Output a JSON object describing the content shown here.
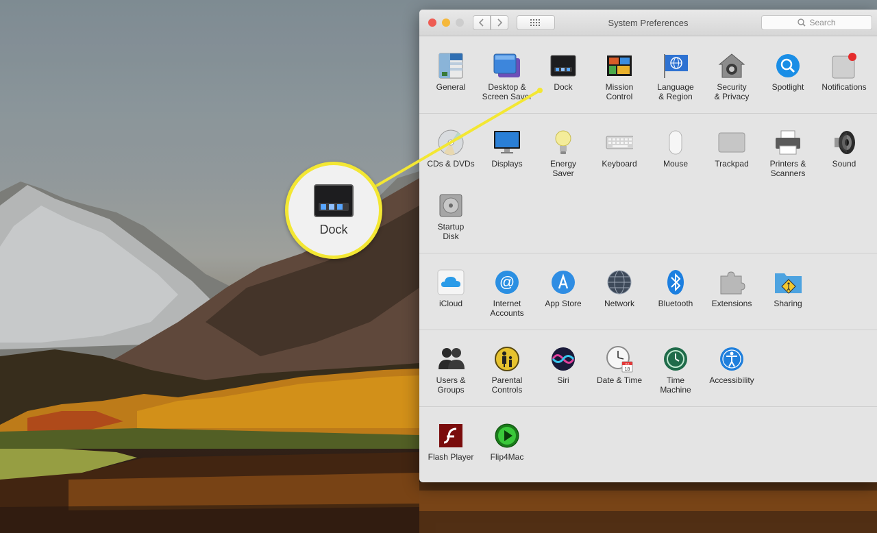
{
  "window": {
    "title": "System Preferences",
    "search_placeholder": "Search"
  },
  "callout": {
    "label": "Dock"
  },
  "sections": [
    {
      "panes": [
        {
          "label": "General",
          "icon": "general-icon"
        },
        {
          "label": "Desktop &\nScreen Saver",
          "icon": "desktop-screen-saver-icon"
        },
        {
          "label": "Dock",
          "icon": "dock-icon"
        },
        {
          "label": "Mission\nControl",
          "icon": "mission-control-icon"
        },
        {
          "label": "Language\n& Region",
          "icon": "language-region-icon"
        },
        {
          "label": "Security\n& Privacy",
          "icon": "security-privacy-icon"
        },
        {
          "label": "Spotlight",
          "icon": "spotlight-icon"
        },
        {
          "label": "Notifications",
          "icon": "notifications-icon"
        }
      ]
    },
    {
      "panes": [
        {
          "label": "CDs & DVDs",
          "icon": "cds-dvds-icon"
        },
        {
          "label": "Displays",
          "icon": "displays-icon"
        },
        {
          "label": "Energy\nSaver",
          "icon": "energy-saver-icon"
        },
        {
          "label": "Keyboard",
          "icon": "keyboard-icon"
        },
        {
          "label": "Mouse",
          "icon": "mouse-icon"
        },
        {
          "label": "Trackpad",
          "icon": "trackpad-icon"
        },
        {
          "label": "Printers &\nScanners",
          "icon": "printers-scanners-icon"
        },
        {
          "label": "Sound",
          "icon": "sound-icon"
        },
        {
          "label": "Startup\nDisk",
          "icon": "startup-disk-icon"
        }
      ]
    },
    {
      "panes": [
        {
          "label": "iCloud",
          "icon": "icloud-icon"
        },
        {
          "label": "Internet\nAccounts",
          "icon": "internet-accounts-icon"
        },
        {
          "label": "App Store",
          "icon": "app-store-icon"
        },
        {
          "label": "Network",
          "icon": "network-icon"
        },
        {
          "label": "Bluetooth",
          "icon": "bluetooth-icon"
        },
        {
          "label": "Extensions",
          "icon": "extensions-icon"
        },
        {
          "label": "Sharing",
          "icon": "sharing-icon"
        }
      ]
    },
    {
      "panes": [
        {
          "label": "Users &\nGroups",
          "icon": "users-groups-icon"
        },
        {
          "label": "Parental\nControls",
          "icon": "parental-controls-icon"
        },
        {
          "label": "Siri",
          "icon": "siri-icon"
        },
        {
          "label": "Date & Time",
          "icon": "date-time-icon"
        },
        {
          "label": "Time\nMachine",
          "icon": "time-machine-icon"
        },
        {
          "label": "Accessibility",
          "icon": "accessibility-icon"
        }
      ]
    },
    {
      "panes": [
        {
          "label": "Flash Player",
          "icon": "flash-player-icon"
        },
        {
          "label": "Flip4Mac",
          "icon": "flip4mac-icon"
        }
      ]
    }
  ],
  "icons": {
    "date_time_month": "JUL",
    "date_time_day": "18"
  },
  "colors": {
    "callout_ring": "#f3e733",
    "close": "#ee5c53",
    "minimize": "#f5b83b"
  }
}
